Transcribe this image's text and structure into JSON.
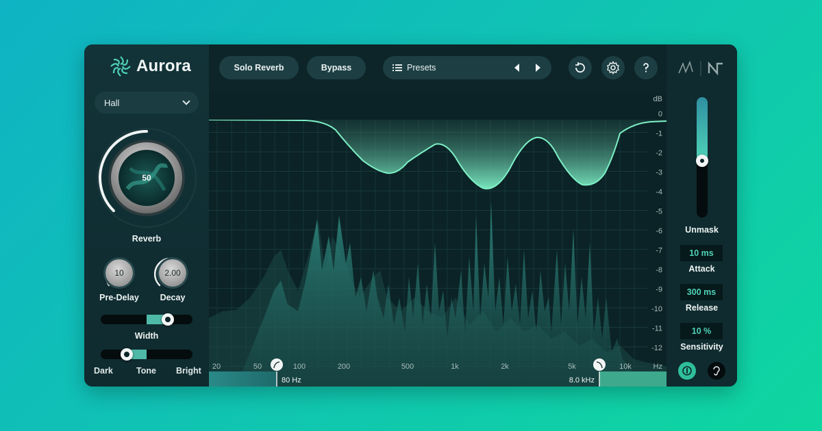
{
  "app": {
    "name": "Aurora"
  },
  "left": {
    "mode": {
      "selected": "Hall"
    },
    "reverb": {
      "value": "50",
      "label": "Reverb",
      "level": 0.5
    },
    "predelay": {
      "value": "10",
      "label": "Pre-Delay"
    },
    "decay": {
      "value": "2.00",
      "label": "Decay"
    },
    "width": {
      "label": "Width",
      "level": 0.77
    },
    "tone": {
      "label": "Tone",
      "dark": "Dark",
      "bright": "Bright",
      "level": 0.25
    }
  },
  "toolbar": {
    "solo_reverb": "Solo Reverb",
    "bypass": "Bypass",
    "presets": "Presets"
  },
  "graph": {
    "db_unit": "dB",
    "db_ticks": [
      "0",
      "-1",
      "-2",
      "-3",
      "-4",
      "-5",
      "-6",
      "-7",
      "-8",
      "-9",
      "-10",
      "-11",
      "-12"
    ],
    "hz_ticks": [
      "20",
      "50",
      "100",
      "200",
      "500",
      "1k",
      "2k",
      "5k",
      "10k"
    ],
    "hz_unit": "Hz",
    "low_cut": "80 Hz",
    "high_cut": "8.0 kHz"
  },
  "right": {
    "unmask": {
      "label": "Unmask",
      "level": 0.53
    },
    "attack": {
      "value": "10 ms",
      "label": "Attack"
    },
    "release": {
      "value": "300 ms",
      "label": "Release"
    },
    "sensitivity": {
      "value": "10 %",
      "label": "Sensitivity"
    }
  },
  "colors": {
    "accent": "#4fd3b8",
    "panel": "#0d2528",
    "pill": "#1d3f44"
  }
}
